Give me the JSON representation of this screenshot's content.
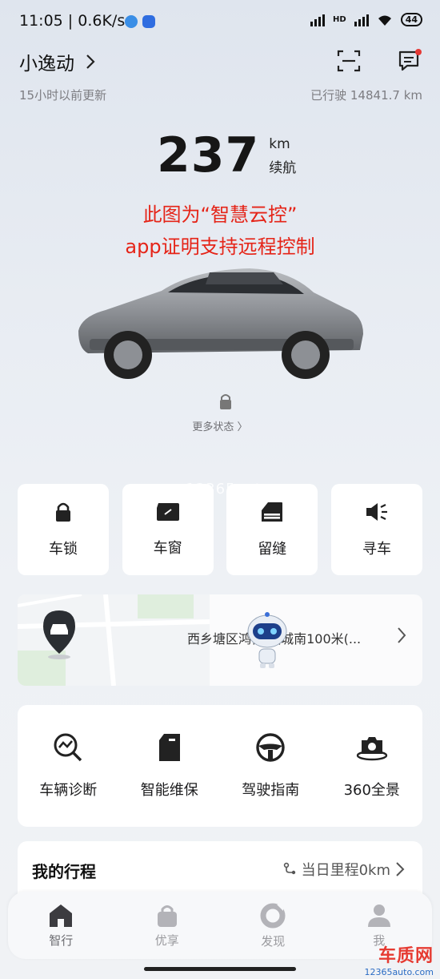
{
  "status_bar": {
    "time": "11:05 | 0.6K/s",
    "battery": "44",
    "network": "HD"
  },
  "header": {
    "car_name": "小逸动",
    "updated": "15小时以前更新",
    "mileage": "已行驶 14841.7 km"
  },
  "range": {
    "value": "237",
    "unit": "km",
    "label": "续航"
  },
  "overlay_note": {
    "line1": "此图为“智慧云控”",
    "line2": "app证明支持远程控制"
  },
  "more_status": "更多状态 〉",
  "quick_controls": [
    {
      "label": "车锁",
      "icon": "lock-icon"
    },
    {
      "label": "车窗",
      "icon": "window-icon"
    },
    {
      "label": "留缝",
      "icon": "window-gap-icon"
    },
    {
      "label": "寻车",
      "icon": "horn-icon"
    }
  ],
  "watermark": "www.12365auto.com",
  "location": {
    "text": "西乡塘区鸿信·福城南100米(..."
  },
  "services": [
    {
      "label": "车辆诊断",
      "icon": "diagnosis-icon"
    },
    {
      "label": "智能维保",
      "icon": "maintenance-icon"
    },
    {
      "label": "驾驶指南",
      "icon": "steering-wheel-icon"
    },
    {
      "label": "360全景",
      "icon": "camera-360-icon"
    }
  ],
  "trip": {
    "title": "我的行程",
    "daily_mileage": "当日里程0km"
  },
  "tabs": [
    {
      "label": "智行",
      "icon": "home-icon",
      "active": true
    },
    {
      "label": "优享",
      "icon": "bag-icon",
      "active": false
    },
    {
      "label": "发现",
      "icon": "discover-icon",
      "active": false
    },
    {
      "label": "我",
      "icon": "profile-icon",
      "active": false
    }
  ],
  "brand": {
    "name": "车质网",
    "url": "12365auto.com"
  },
  "colors": {
    "accent_red": "#e52418",
    "notification_dot": "#e53935",
    "brand_red": "#e63b32",
    "brand_blue": "#2b6cc4"
  }
}
